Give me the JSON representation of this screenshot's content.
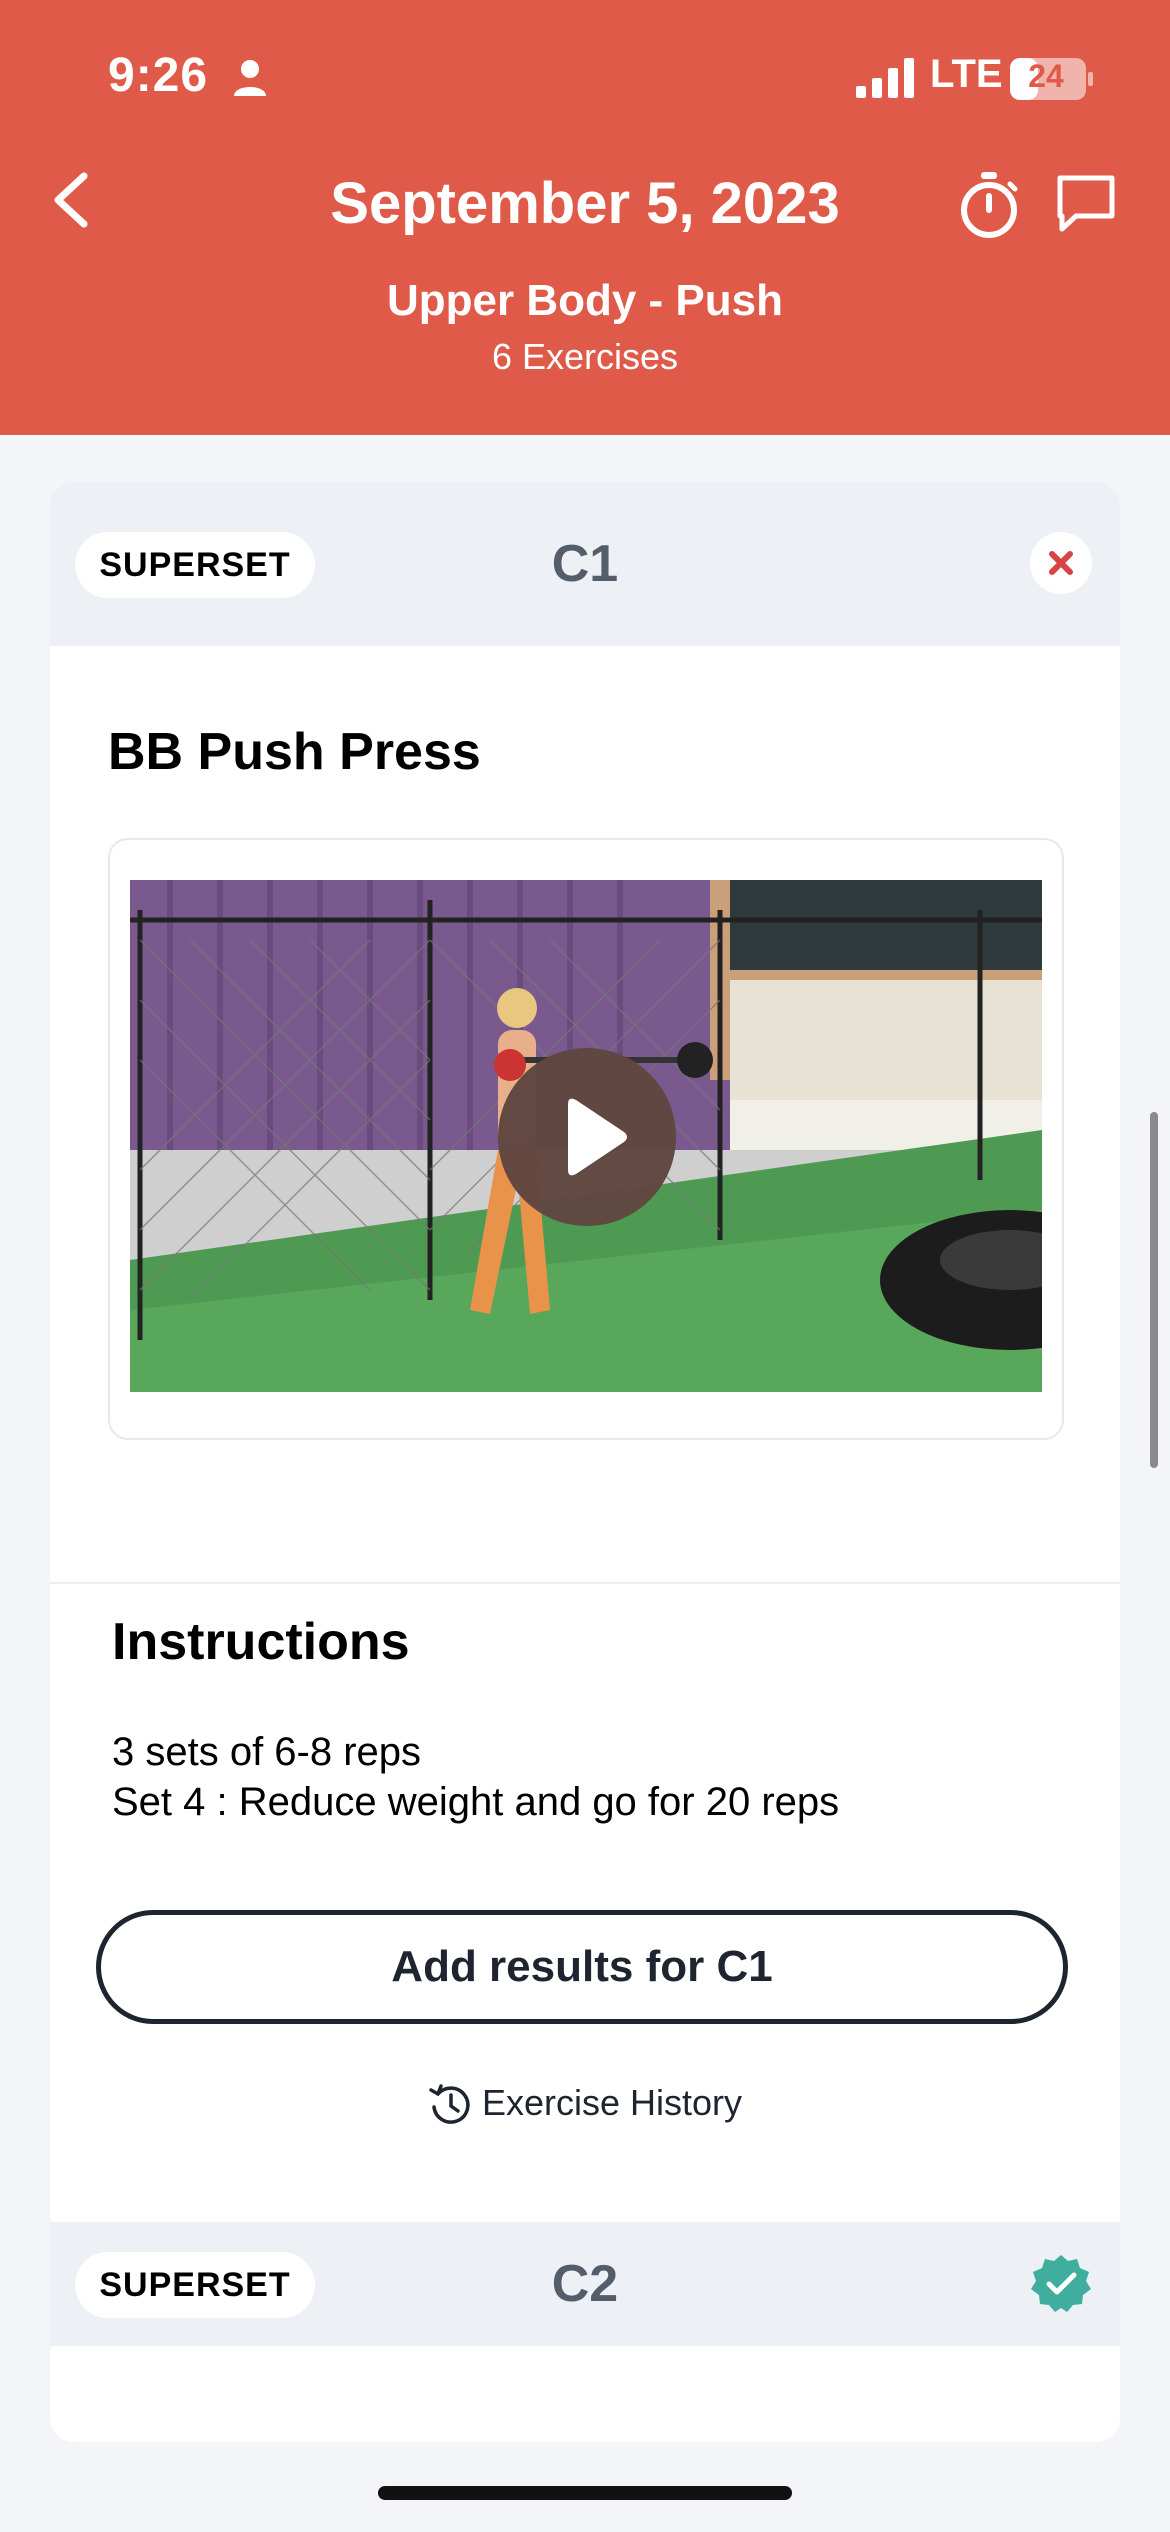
{
  "status_bar": {
    "time": "9:26",
    "network": "LTE",
    "battery": "24"
  },
  "header": {
    "title": "September 5, 2023",
    "subtitle": "Upper Body - Push",
    "count": "6 Exercises"
  },
  "supersets": [
    {
      "tag": "SUPERSET",
      "code": "C1",
      "action_icon": "close-icon"
    },
    {
      "tag": "SUPERSET",
      "code": "C2",
      "action_icon": "check-badge-icon"
    }
  ],
  "exercise": {
    "name": "BB Push Press",
    "video_icon": "play-icon"
  },
  "instructions": {
    "title": "Instructions",
    "lines": [
      "3 sets of 6-8 reps",
      "Set 4 : Reduce weight and go for 20 reps"
    ]
  },
  "actions": {
    "add_results": "Add results for C1",
    "history": "Exercise History"
  },
  "colors": {
    "header": "#df5a48",
    "close": "#d64444",
    "check": "#3fae9e",
    "code_text": "#535d6b"
  }
}
